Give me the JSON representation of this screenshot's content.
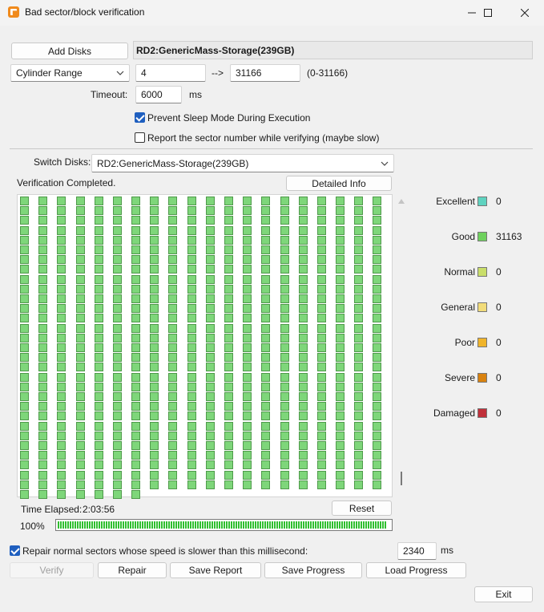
{
  "window": {
    "title": "Bad sector/block verification"
  },
  "top": {
    "add_disks_label": "Add Disks",
    "disk_name": "RD2:GenericMass-Storage(239GB)",
    "range_mode": "Cylinder Range",
    "range_start": "4",
    "range_arrow": "-->",
    "range_end": "31166",
    "range_hint": "(0-31166)",
    "timeout_label": "Timeout:",
    "timeout_value": "6000",
    "timeout_unit": "ms",
    "prevent_sleep_label": "Prevent Sleep Mode During Execution",
    "prevent_sleep_checked": true,
    "report_sector_label": "Report the sector number while verifying (maybe slow)",
    "report_sector_checked": false
  },
  "scan": {
    "switch_disks_label": "Switch Disks:",
    "switch_disks_value": "RD2:GenericMass-Storage(239GB)",
    "status": "Verification Completed.",
    "detailed_info_label": "Detailed Info",
    "grid": {
      "columns": 20,
      "full_rows": 30,
      "last_row_cells": 7,
      "cell_color": "#7ed67a"
    },
    "time_elapsed_label": "Time Elapsed:",
    "time_elapsed_value": "2:03:56",
    "reset_label": "Reset",
    "progress_percent_text": "100%",
    "progress_value": 100
  },
  "legend": [
    {
      "label": "Excellent",
      "color": "#5fd3c0",
      "count": "0"
    },
    {
      "label": "Good",
      "color": "#6fd15e",
      "count": "31163"
    },
    {
      "label": "Normal",
      "color": "#c9de6a",
      "count": "0"
    },
    {
      "label": "General",
      "color": "#f2dc7a",
      "count": "0"
    },
    {
      "label": "Poor",
      "color": "#f0b42a",
      "count": "0"
    },
    {
      "label": "Severe",
      "color": "#d9820f",
      "count": "0"
    },
    {
      "label": "Damaged",
      "color": "#c0303a",
      "count": "0"
    }
  ],
  "repair": {
    "threshold_label": "Repair normal sectors whose speed is slower than this millisecond:",
    "threshold_checked": true,
    "threshold_value": "2340",
    "threshold_unit": "ms"
  },
  "actions": {
    "verify_label": "Verify",
    "repair_label": "Repair",
    "save_report_label": "Save Report",
    "save_progress_label": "Save Progress",
    "load_progress_label": "Load Progress",
    "exit_label": "Exit"
  }
}
